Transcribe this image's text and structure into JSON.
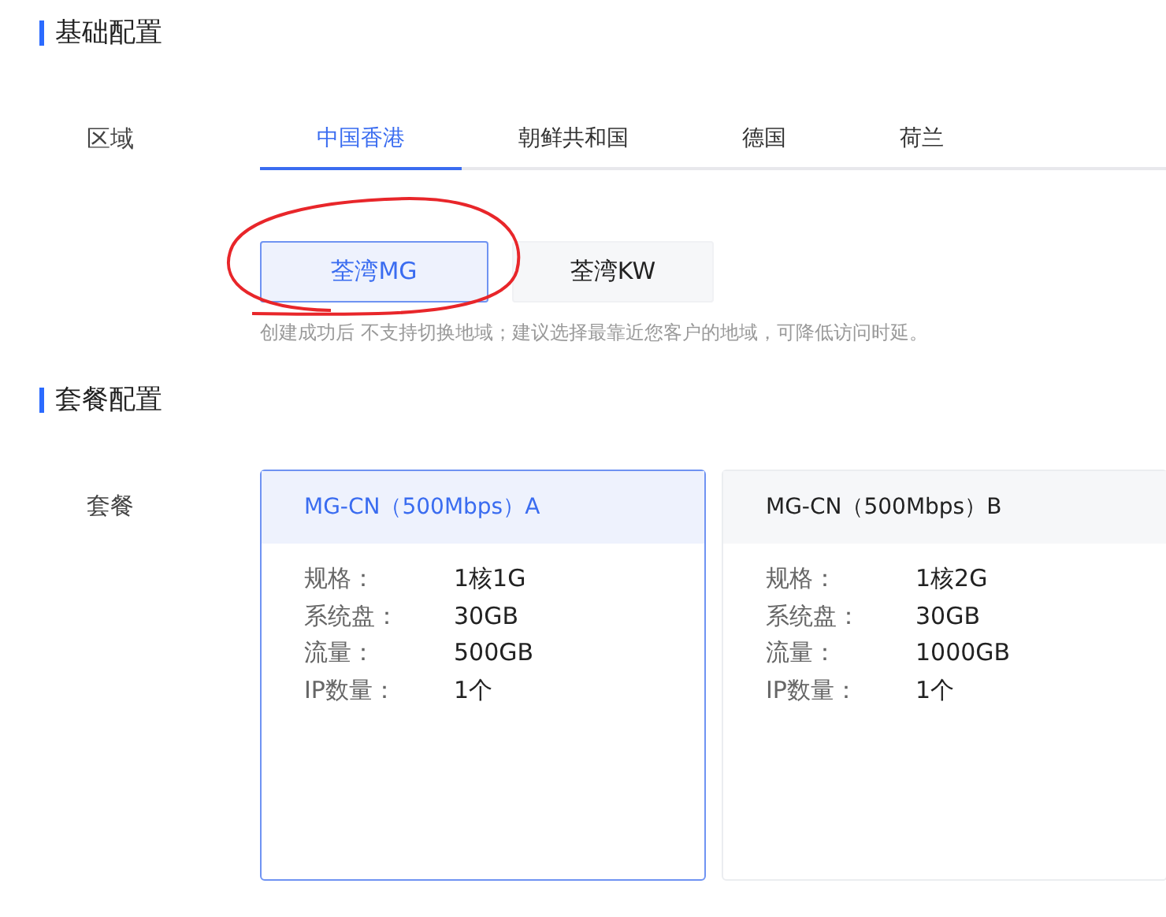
{
  "basic_config": {
    "title": "基础配置",
    "region_label": "区域",
    "tabs": [
      {
        "label": "中国香港",
        "selected": true
      },
      {
        "label": "朝鲜共和国",
        "selected": false
      },
      {
        "label": "德国",
        "selected": false
      },
      {
        "label": "荷兰",
        "selected": false
      }
    ],
    "zones": [
      {
        "label": "荃湾MG",
        "selected": true
      },
      {
        "label": "荃湾KW",
        "selected": false
      }
    ],
    "hint": "创建成功后 不支持切换地域；建议选择最靠近您客户的地域，可降低访问时延。"
  },
  "package_config": {
    "title": "套餐配置",
    "package_label": "套餐",
    "plans": [
      {
        "name": "MG-CN（500Mbps）A",
        "selected": true,
        "specs": [
          {
            "label": "规格：",
            "value": "1核1G"
          },
          {
            "label": "系统盘：",
            "value": "30GB"
          },
          {
            "label": "流量：",
            "value": "500GB"
          },
          {
            "label": "IP数量：",
            "value": "1个"
          }
        ]
      },
      {
        "name": "MG-CN（500Mbps）B",
        "selected": false,
        "specs": [
          {
            "label": "规格：",
            "value": "1核2G"
          },
          {
            "label": "系统盘：",
            "value": "30GB"
          },
          {
            "label": "流量：",
            "value": "1000GB"
          },
          {
            "label": "IP数量：",
            "value": "1个"
          }
        ]
      }
    ]
  }
}
